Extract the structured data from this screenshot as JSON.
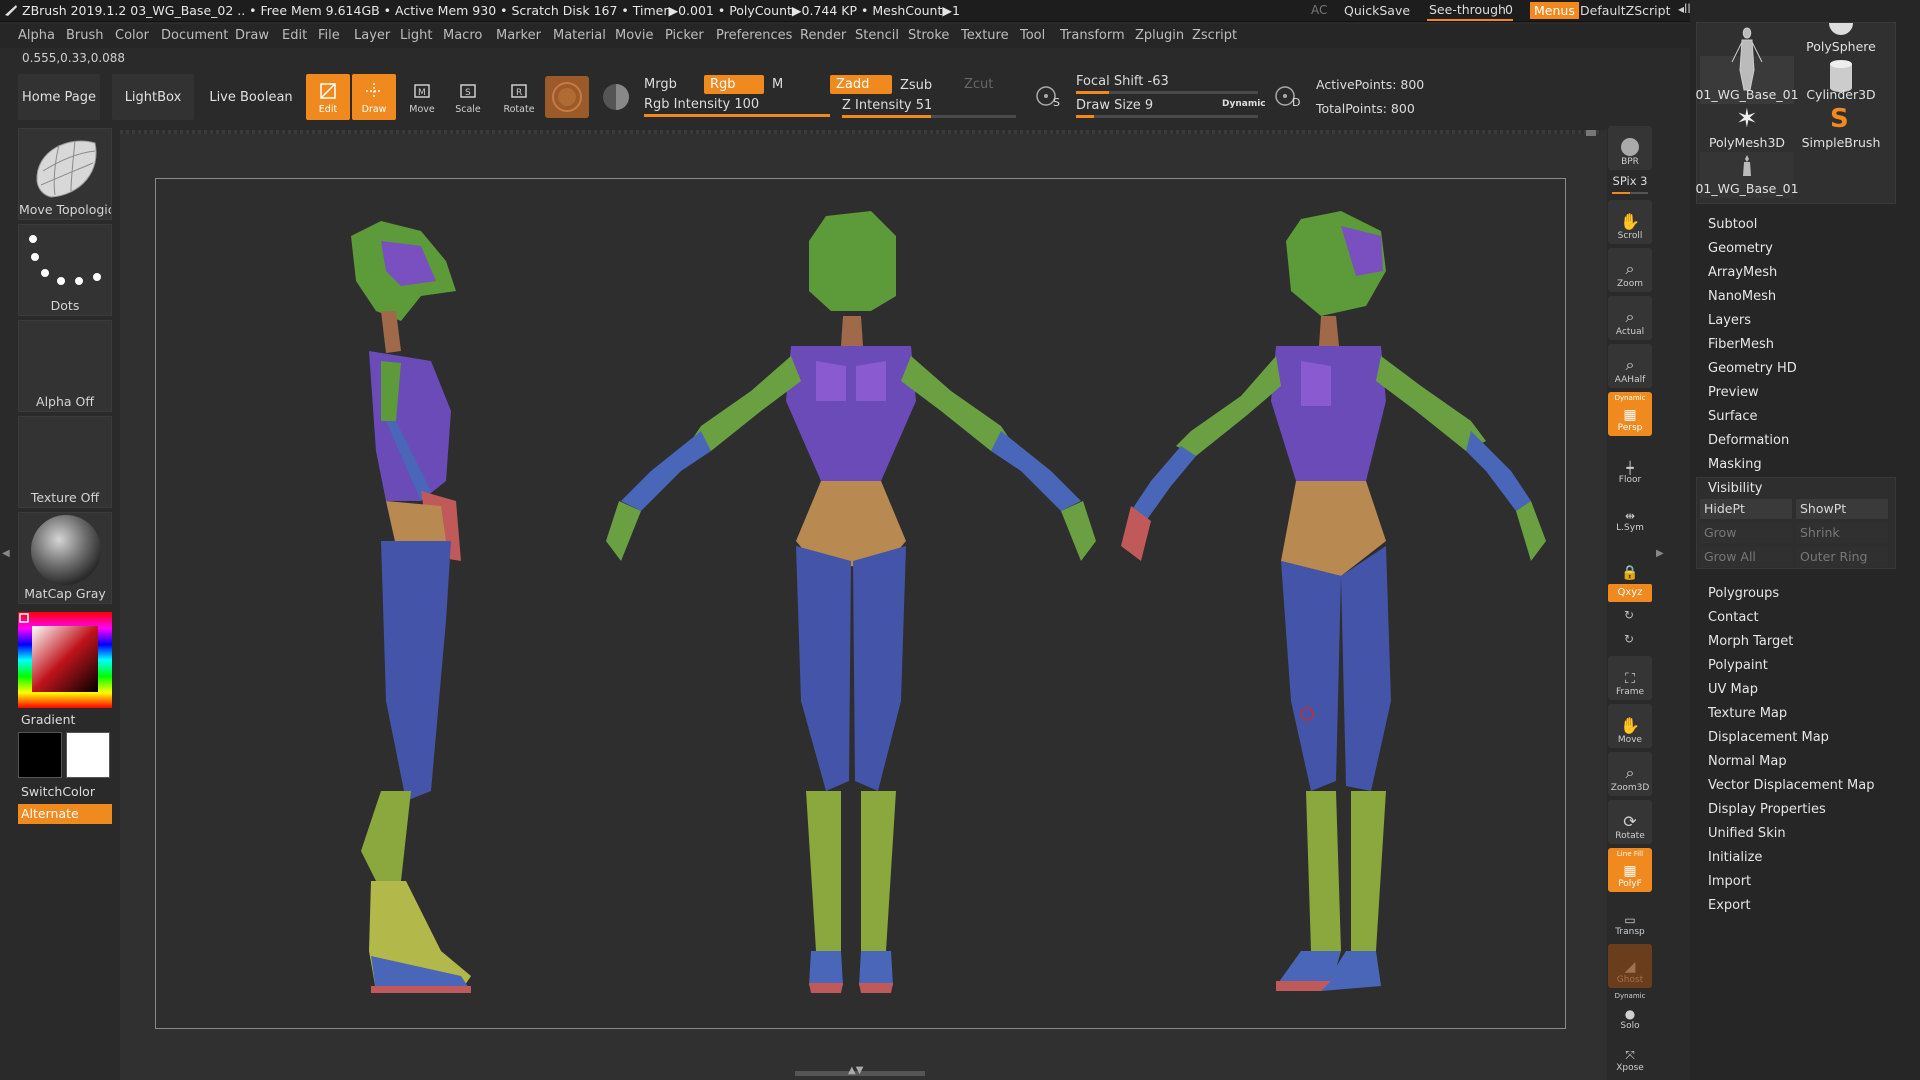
{
  "title": "ZBrush 2019.1.2   03_WG_Base_02   .. • Free Mem 9.614GB • Active Mem 930 • Scratch Disk 167 •  Timer▶0.001 • PolyCount▶0.744 KP  • MeshCount▶1",
  "titlebar_right": {
    "ac": "AC",
    "quicksave": "QuickSave",
    "seethrough": "See-through",
    "seethrough_value": "0",
    "seethrough_level": 0,
    "menus": "Menus",
    "script": "DefaultZScript"
  },
  "menus": [
    "Alpha",
    "Brush",
    "Color",
    "Document",
    "Draw",
    "Edit",
    "File",
    "Layer",
    "Light",
    "Macro",
    "Marker",
    "Material",
    "Movie",
    "Picker",
    "Preferences",
    "Render",
    "Stencil",
    "Stroke",
    "Texture",
    "Tool",
    "Transform",
    "Zplugin",
    "Zscript"
  ],
  "coordinates": "0.555,0.33,0.088",
  "top_buttons": {
    "home": "Home Page",
    "lightbox": "LightBox",
    "liveboolean": "Live Boolean"
  },
  "tools": {
    "edit": "Edit",
    "draw": "Draw",
    "move": "Move",
    "scale": "Scale",
    "rotate": "Rotate"
  },
  "draw_controls": {
    "mrgb": "Mrgb",
    "rgb": "Rgb",
    "m": "M",
    "zadd": "Zadd",
    "zsub": "Zsub",
    "zcut": "Zcut",
    "rgb_intensity": "Rgb Intensity 100",
    "rgb_intensity_value": 100,
    "z_intensity": "Z Intensity 51",
    "z_intensity_value": 51,
    "focal_shift": "Focal Shift -63",
    "focal_shift_value": -63,
    "draw_size": "Draw Size 9",
    "draw_size_value": 9,
    "dynamic": "Dynamic",
    "s_label": "S",
    "d_label": "D",
    "active_points": "ActivePoints: 800",
    "total_points": "TotalPoints: 800"
  },
  "left_shelf": {
    "brush": "Move Topological",
    "stroke": "Dots",
    "alpha": "Alpha Off",
    "texture": "Texture Off",
    "material": "MatCap Gray",
    "gradient": "Gradient",
    "switchcolor": "SwitchColor",
    "alternate": "Alternate"
  },
  "right_shelf": {
    "bpr": "BPR",
    "spix": "SPix 3",
    "spix_value": 3,
    "scroll": "Scroll",
    "zoom": "Zoom",
    "actual": "Actual",
    "aahalf": "AAHalf",
    "persp_top": "Dynamic",
    "persp": "Persp",
    "floor": "Floor",
    "lsym": "L.Sym",
    "xyz": "Qxyz",
    "frame": "Frame",
    "move": "Move",
    "zoom3d": "Zoom3D",
    "rotate": "Rotate",
    "polyf_top": "Line Fill",
    "polyf": "PolyF",
    "transp": "Transp",
    "ghost": "Ghost",
    "solo_top": "Dynamic",
    "solo": "Solo",
    "xpose": "Xpose"
  },
  "tool_palette": {
    "tiles": [
      "01_WG_Base_01",
      "PolySphere",
      "Cylinder3D",
      "PolyMesh3D",
      "SimpleBrush",
      "01_WG_Base_01"
    ],
    "subpalettes_a": [
      "Subtool",
      "Geometry",
      "ArrayMesh",
      "NanoMesh",
      "Layers",
      "FiberMesh",
      "Geometry HD",
      "Preview",
      "Surface",
      "Deformation",
      "Masking",
      "Visibility"
    ],
    "visibility_buttons": [
      "HidePt",
      "ShowPt",
      "Grow",
      "Shrink",
      "Grow All",
      "Outer Ring"
    ],
    "subpalettes_b": [
      "Polygroups",
      "Contact",
      "Morph Target",
      "Polypaint",
      "UV Map",
      "Texture Map",
      "Displacement Map",
      "Normal Map",
      "Vector Displacement Map",
      "Display Properties",
      "Unified Skin",
      "Initialize",
      "Import",
      "Export"
    ]
  },
  "colors": {
    "accent": "#f0891e",
    "bg": "#2a2a2a",
    "panel": "#262626",
    "purple": "#6a4bb8",
    "green": "#5c9a3a",
    "blue": "#4454a8",
    "tan": "#b88a52"
  }
}
